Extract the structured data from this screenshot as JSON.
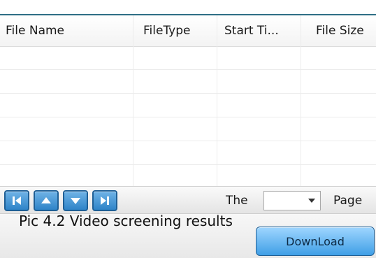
{
  "table": {
    "columns": [
      {
        "label": "File Name"
      },
      {
        "label": "FileType"
      },
      {
        "label": "Start Ti..."
      },
      {
        "label": "File Size"
      }
    ],
    "rows": [
      [
        "",
        "",
        "",
        ""
      ],
      [
        "",
        "",
        "",
        ""
      ],
      [
        "",
        "",
        "",
        ""
      ],
      [
        "",
        "",
        "",
        ""
      ],
      [
        "",
        "",
        "",
        ""
      ],
      [
        "",
        "",
        "",
        ""
      ]
    ]
  },
  "pager": {
    "buttons": [
      {
        "icon": "first-page-icon"
      },
      {
        "icon": "previous-page-icon"
      },
      {
        "icon": "next-page-icon"
      },
      {
        "icon": "last-page-icon"
      }
    ],
    "prefix_label": "The",
    "page_value": "",
    "suffix_label": "Page"
  },
  "caption": "Pic 4.2 Video screening results",
  "download_label": "DownLoad",
  "colors": {
    "accent": "#2f84c8",
    "accent_dark": "#1f5f95",
    "top_line": "#2f6f86"
  }
}
